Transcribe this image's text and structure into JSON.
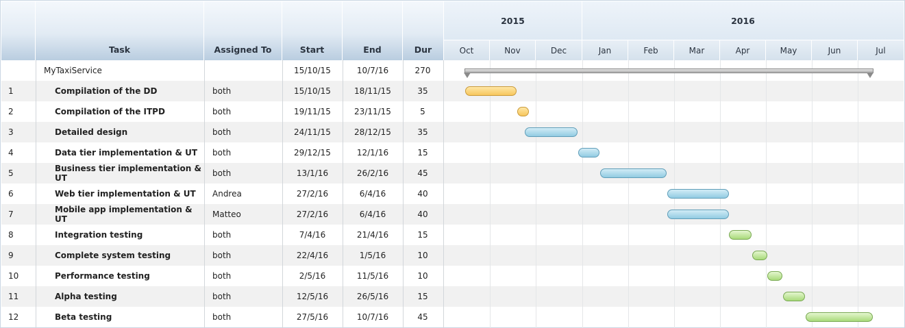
{
  "columns": {
    "num": "",
    "task": "Task",
    "assigned": "Assigned To",
    "start": "Start",
    "end": "End",
    "dur": "Dur"
  },
  "timeline": {
    "years": [
      "2015",
      "2016"
    ],
    "months": [
      "Oct",
      "Nov",
      "Dec",
      "Jan",
      "Feb",
      "Mar",
      "Apr",
      "May",
      "Jun",
      "Jul"
    ]
  },
  "summary": {
    "task": "MyTaxiService",
    "assigned": "",
    "start": "15/10/15",
    "end": "10/7/16",
    "dur": "270"
  },
  "tasks": [
    {
      "num": "1",
      "task": "Compilation of the DD",
      "assigned": "both",
      "start": "15/10/15",
      "end": "18/11/15",
      "dur": "35",
      "color": "yellow"
    },
    {
      "num": "2",
      "task": "Compilation of the ITPD",
      "assigned": "both",
      "start": "19/11/15",
      "end": "23/11/15",
      "dur": "5",
      "color": "yellow"
    },
    {
      "num": "3",
      "task": "Detailed design",
      "assigned": "both",
      "start": "24/11/15",
      "end": "28/12/15",
      "dur": "35",
      "color": "blue"
    },
    {
      "num": "4",
      "task": "Data tier implementation & UT",
      "assigned": "both",
      "start": "29/12/15",
      "end": "12/1/16",
      "dur": "15",
      "color": "blue"
    },
    {
      "num": "5",
      "task": "Business tier implementation & UT",
      "assigned": "both",
      "start": "13/1/16",
      "end": "26/2/16",
      "dur": "45",
      "color": "blue"
    },
    {
      "num": "6",
      "task": "Web tier implementation & UT",
      "assigned": "Andrea",
      "start": "27/2/16",
      "end": "6/4/16",
      "dur": "40",
      "color": "blue"
    },
    {
      "num": "7",
      "task": "Mobile app implementation & UT",
      "assigned": "Matteo",
      "start": "27/2/16",
      "end": "6/4/16",
      "dur": "40",
      "color": "blue"
    },
    {
      "num": "8",
      "task": "Integration testing",
      "assigned": "both",
      "start": "7/4/16",
      "end": "21/4/16",
      "dur": "15",
      "color": "green"
    },
    {
      "num": "9",
      "task": "Complete system testing",
      "assigned": "both",
      "start": "22/4/16",
      "end": "1/5/16",
      "dur": "10",
      "color": "green"
    },
    {
      "num": "10",
      "task": "Performance testing",
      "assigned": "both",
      "start": "2/5/16",
      "end": "11/5/16",
      "dur": "10",
      "color": "green"
    },
    {
      "num": "11",
      "task": "Alpha testing",
      "assigned": "both",
      "start": "12/5/16",
      "end": "26/5/16",
      "dur": "15",
      "color": "green"
    },
    {
      "num": "12",
      "task": "Beta testing",
      "assigned": "both",
      "start": "27/5/16",
      "end": "10/7/16",
      "dur": "45",
      "color": "green"
    }
  ],
  "colors": {
    "yellow": "#f7c65c",
    "blue": "#92cbe2",
    "green": "#a9da7a"
  }
}
